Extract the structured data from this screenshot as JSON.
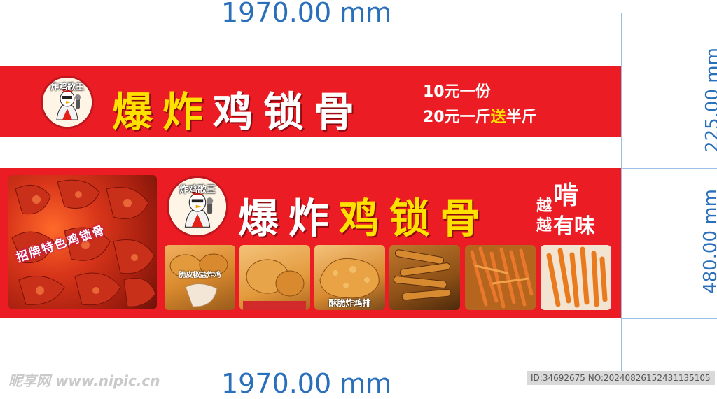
{
  "dimensions": {
    "top_width": "1970.00 mm",
    "bottom_width": "1970.00 mm",
    "banner1_height": "225.00 mm",
    "banner2_height": "480.00 mm"
  },
  "banner1": {
    "logo_text": "炸鸡歌王",
    "title_chars": [
      "爆",
      "炸",
      "鸡",
      "锁",
      "骨"
    ],
    "price_line1": "10元一份",
    "price_line2_a": "20元一斤",
    "price_line2_b": "送",
    "price_line2_c": "半斤"
  },
  "banner2": {
    "feature_caption": "招牌特色鸡锁骨",
    "logo_text": "炸鸡歌王",
    "title_chars": [
      "爆",
      "炸",
      "鸡",
      "锁",
      "骨"
    ],
    "side_1": "越",
    "side_2": "啃",
    "side_3": "越",
    "side_4": "有味",
    "photos": [
      {
        "caption": "脆皮椒盐炸鸡"
      },
      {
        "caption": ""
      },
      {
        "caption": "酥脆炸鸡排"
      },
      {
        "caption": ""
      },
      {
        "caption": ""
      },
      {
        "caption": ""
      }
    ]
  },
  "footer": {
    "watermark": "昵享网 www.nipic.cn",
    "id_text": "ID:34692675 NO:20240826152431135105"
  },
  "colors": {
    "banner_red": "#ec1c24",
    "title_yellow": "#ffe100",
    "title_white": "#ffffff",
    "dimension_blue": "#2a6fba"
  }
}
